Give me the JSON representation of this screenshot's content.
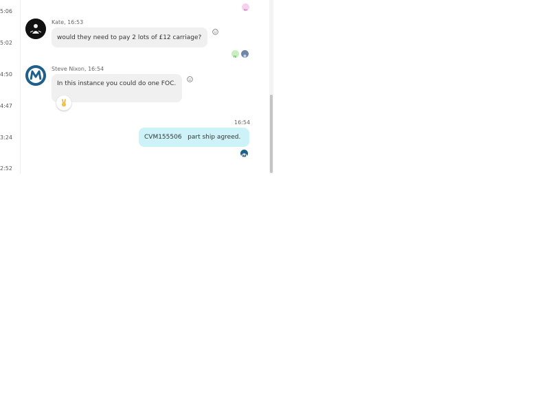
{
  "timeline": {
    "timestamps": [
      "5:06",
      "5:02",
      "4:50",
      "4:47",
      "3:24",
      "2:52"
    ]
  },
  "messages": [
    {
      "sender": "Kate",
      "time": "16:53",
      "meta": "Kate, 16:53",
      "text": "would they need to pay 2 lots of £12 carriage?",
      "avatar_icon": "silhouette-avatar-icon"
    },
    {
      "sender": "Steve Nixon",
      "time": "16:54",
      "meta": "Steve Nixon, 16:54",
      "text": "In this instance you could do one FOC.",
      "avatar_icon": "m-logo-avatar-icon",
      "reaction": "victory-hand-icon"
    },
    {
      "sender": "me",
      "time": "16:54",
      "text": "CVM155506   part ship agreed."
    }
  ],
  "read_receipts": {
    "top": "avatar-pink",
    "kate": [
      "avatar-green",
      "avatar-blue"
    ],
    "mine": [
      "m-logo"
    ]
  },
  "colors": {
    "incoming_bubble": "#f0f0f0",
    "outgoing_bubble": "#cdf3f8",
    "brand_blue": "#1f5f8b"
  }
}
